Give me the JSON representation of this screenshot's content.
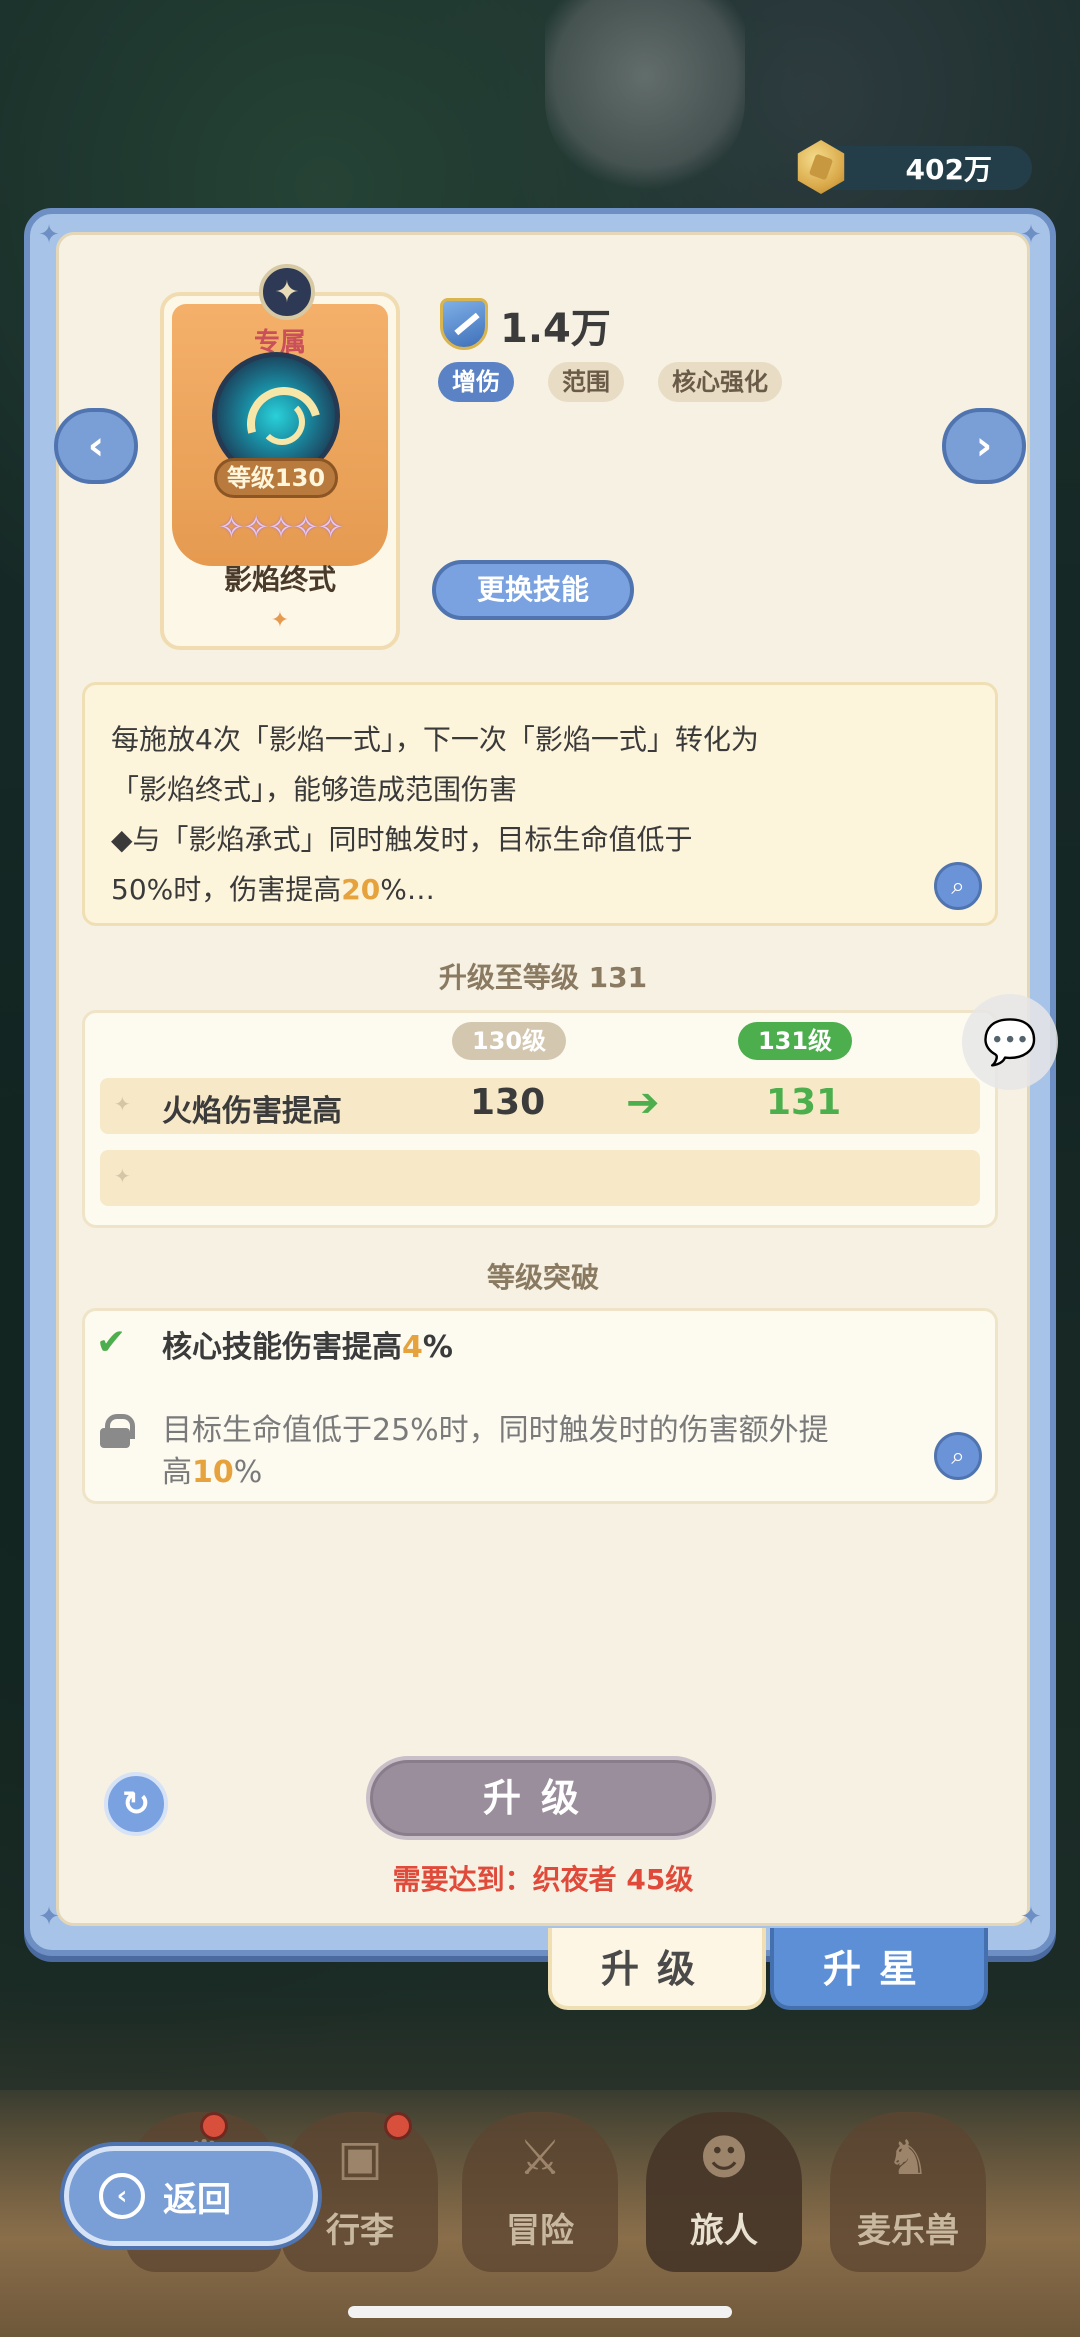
{
  "currency": {
    "amount": "402万",
    "icon": "gold-coin-icon"
  },
  "skill": {
    "exclusive_label": "专属",
    "level_label": "等级130",
    "stars": "✧✧✧✧✧",
    "name": "影焰终式",
    "power": "1.4万",
    "tags": [
      "增伤",
      "范围",
      "核心强化"
    ],
    "swap_button": "更换技能",
    "description_line1": "每施放4次「影焰一式」，下一次「影焰一式」转化为",
    "description_line2": "「影焰终式」，能够造成范围伤害",
    "description_line3": "◆与「影焰承式」同时触发时，目标生命值低于",
    "description_line4_pre": "50%时，伤害提高",
    "description_line4_hl": "20",
    "description_line4_post": "%…"
  },
  "upgrade": {
    "title": "升级至等级 131",
    "current_level": "130级",
    "next_level": "131级",
    "rows": [
      {
        "label": "火焰伤害提高",
        "current": "130",
        "next": "131",
        "arrow": "➔"
      }
    ]
  },
  "breakthrough": {
    "title": "等级突破",
    "item1_pre": "核心技能伤害提高",
    "item1_hl": "4",
    "item1_post": "%",
    "item2_line1": "目标生命值低于25%时，同时触发时的伤害额外提",
    "item2_line2_pre": "高",
    "item2_line2_hl": "10",
    "item2_line2_post": "%"
  },
  "actions": {
    "upgrade_button": "升级",
    "requirement": "需要达到：织夜者  45级"
  },
  "tabs": {
    "upgrade": "升级",
    "star": "升星"
  },
  "bottom_nav": {
    "back": "返回",
    "items": [
      "行李",
      "冒险",
      "旅人",
      "麦乐兽"
    ]
  },
  "colors": {
    "panel_blue": "#6d8fc4",
    "panel_cream": "#f6f1e2",
    "highlight_orange": "#e6a23c",
    "highlight_green": "#4cae4c",
    "warning_red": "#e04a3a"
  }
}
